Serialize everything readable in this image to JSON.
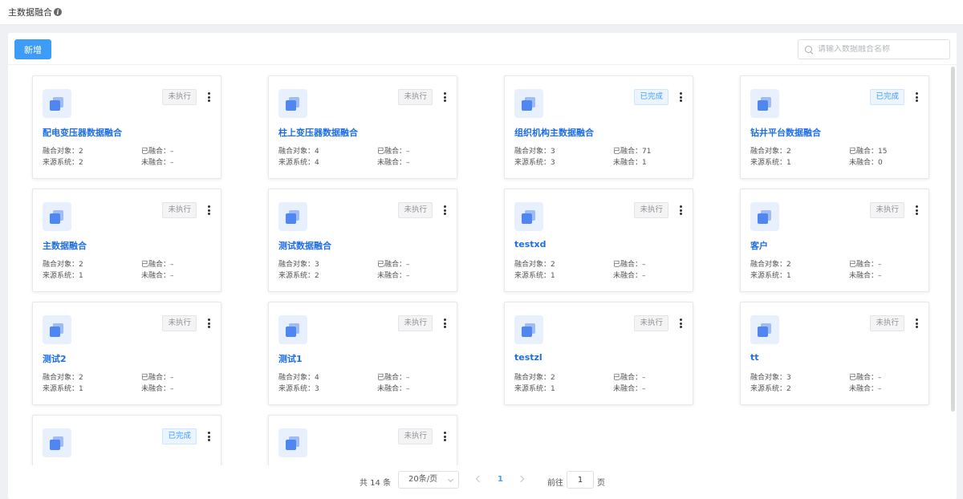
{
  "header": {
    "title": "主数据融合",
    "info_icon": "info-icon"
  },
  "toolbar": {
    "new_label": "新增",
    "search_placeholder": "请输入数据融合名称"
  },
  "labels": {
    "objects": "融合对象：",
    "merged": "已融合：",
    "sources": "来源系统：",
    "unmerged": "未融合："
  },
  "cards": [
    {
      "name": "配电变压器数据融合",
      "status": "未执行",
      "status_type": "pending",
      "objects": "2",
      "merged": "–",
      "sources": "2",
      "unmerged": "–"
    },
    {
      "name": "柱上变压器数据融合",
      "status": "未执行",
      "status_type": "pending",
      "objects": "4",
      "merged": "–",
      "sources": "4",
      "unmerged": "–"
    },
    {
      "name": "组织机构主数据融合",
      "status": "已完成",
      "status_type": "done",
      "objects": "3",
      "merged": "71",
      "sources": "3",
      "unmerged": "1"
    },
    {
      "name": "钻井平台数据融合",
      "status": "已完成",
      "status_type": "done",
      "objects": "2",
      "merged": "15",
      "sources": "1",
      "unmerged": "0"
    },
    {
      "name": "主数据融合",
      "status": "未执行",
      "status_type": "pending",
      "objects": "2",
      "merged": "–",
      "sources": "1",
      "unmerged": "–"
    },
    {
      "name": "测试数据融合",
      "status": "未执行",
      "status_type": "pending",
      "objects": "3",
      "merged": "–",
      "sources": "2",
      "unmerged": "–"
    },
    {
      "name": "testxd",
      "status": "未执行",
      "status_type": "pending",
      "objects": "2",
      "merged": "–",
      "sources": "1",
      "unmerged": "–"
    },
    {
      "name": "客户",
      "status": "未执行",
      "status_type": "pending",
      "objects": "2",
      "merged": "–",
      "sources": "1",
      "unmerged": "–"
    },
    {
      "name": "测试2",
      "status": "未执行",
      "status_type": "pending",
      "objects": "2",
      "merged": "–",
      "sources": "1",
      "unmerged": "–"
    },
    {
      "name": "测试1",
      "status": "未执行",
      "status_type": "pending",
      "objects": "4",
      "merged": "–",
      "sources": "3",
      "unmerged": "–"
    },
    {
      "name": "testzl",
      "status": "未执行",
      "status_type": "pending",
      "objects": "2",
      "merged": "–",
      "sources": "1",
      "unmerged": "–"
    },
    {
      "name": "tt",
      "status": "未执行",
      "status_type": "pending",
      "objects": "3",
      "merged": "–",
      "sources": "2",
      "unmerged": "–"
    },
    {
      "status": "已完成",
      "status_type": "done"
    },
    {
      "status": "未执行",
      "status_type": "pending"
    }
  ],
  "pagination": {
    "total": "共 14 条",
    "page_size": "20条/页",
    "current": "1",
    "goto_label": "前往",
    "goto_value": "1",
    "unit": "页"
  }
}
